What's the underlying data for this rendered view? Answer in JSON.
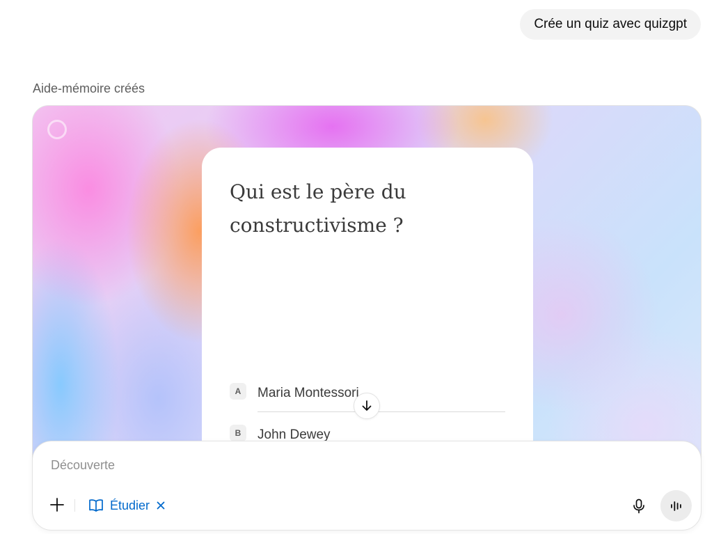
{
  "conversation": {
    "user_message": "Crée un quiz avec quizgpt"
  },
  "flashcards": {
    "section_label": "Aide-mémoire créés",
    "question": "Qui est le père du constructivisme ?",
    "answers": [
      {
        "letter": "A",
        "text": "Maria Montessori"
      },
      {
        "letter": "B",
        "text": "John Dewey"
      }
    ]
  },
  "composer": {
    "placeholder": "Découverte",
    "tool_chip_label": "Étudier",
    "accent_color": "#0169cc"
  },
  "icons": {
    "loading": "loading-spinner-icon",
    "scroll": "arrow-down-icon",
    "add": "plus-icon",
    "study": "open-book-icon",
    "remove_tool": "close-icon",
    "dictate": "microphone-icon",
    "voice": "voice-waveform-icon"
  }
}
